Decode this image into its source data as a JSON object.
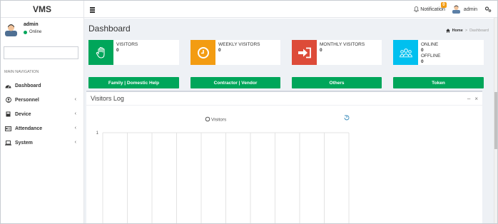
{
  "app": {
    "brand": "VMS"
  },
  "topbar": {
    "notification_label": "Notification",
    "notification_count": "0",
    "user_name": "admin"
  },
  "sidebar": {
    "user_name": "admin",
    "user_status": "Online",
    "search_placeholder": "",
    "nav_header": "MAIN NAVIGATION",
    "items": [
      {
        "label": "Dashboard",
        "icon": "dashboard-icon",
        "has_children": false
      },
      {
        "label": "Personnel",
        "icon": "user-icon",
        "has_children": true
      },
      {
        "label": "Device",
        "icon": "device-icon",
        "has_children": true
      },
      {
        "label": "Attendance",
        "icon": "id-card-icon",
        "has_children": true
      },
      {
        "label": "System",
        "icon": "laptop-icon",
        "has_children": true
      }
    ],
    "chevron": "‹"
  },
  "content": {
    "title": "Dashboard",
    "breadcrumb": {
      "home": "Home",
      "separator": ">",
      "current": "Dashboard"
    }
  },
  "stat_boxes": [
    {
      "label": "VISITORS",
      "value": "0",
      "color": "#00a65a",
      "icon": "hand-icon"
    },
    {
      "label": "WEEKLY VISITORS",
      "value": "0",
      "color": "#f39c12",
      "icon": "clock-icon"
    },
    {
      "label": "MONTHLY VISITORS",
      "value": "0",
      "color": "#dd4b39",
      "icon": "sign-in-icon"
    },
    {
      "label": "ONLINE",
      "value": "0",
      "label2": "OFFLINE",
      "value2": "0",
      "color": "#00c0ef",
      "icon": "users-icon"
    }
  ],
  "action_buttons": [
    {
      "label": "Family | Domestic Help",
      "color": "#00a65a"
    },
    {
      "label": "Contractor | Vendor",
      "color": "#00a65a"
    },
    {
      "label": "Others",
      "color": "#00a65a"
    },
    {
      "label": "Token",
      "color": "#00a65a"
    }
  ],
  "visitors_log": {
    "title": "Visitors Log",
    "collapse": "–",
    "close": "×"
  },
  "chart_data": {
    "type": "line",
    "title": "",
    "legend": [
      "Visitors"
    ],
    "series": [
      {
        "name": "Visitors",
        "values": []
      }
    ],
    "x": [],
    "xlabel": "",
    "ylabel": "",
    "y_ticks": [
      "1"
    ],
    "ylim": [
      0,
      1
    ],
    "grid": true,
    "vertical_grid_count": 10,
    "legend_position": "top-center"
  }
}
